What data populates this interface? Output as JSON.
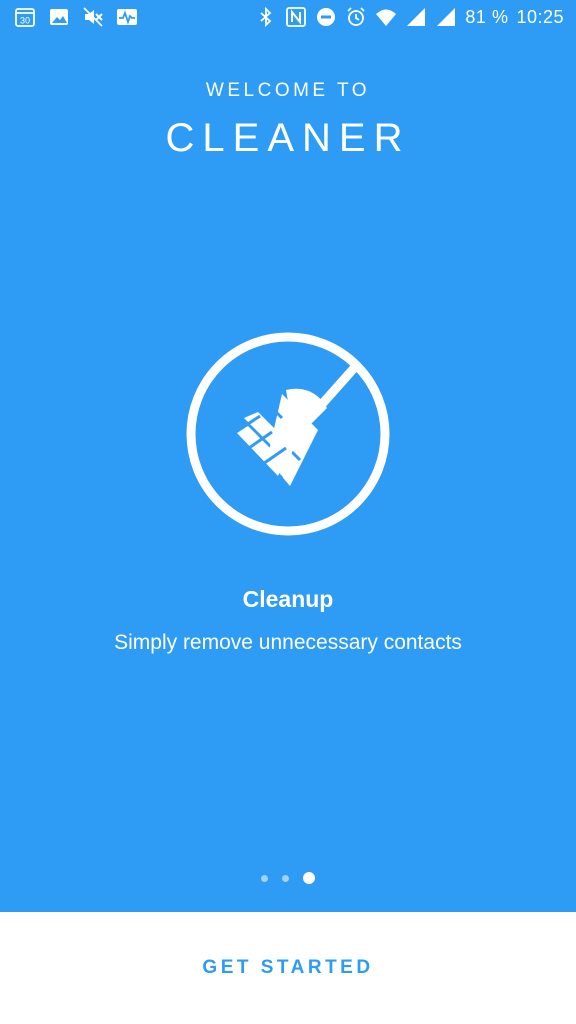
{
  "status_bar": {
    "battery_text": "81 %",
    "time": "10:25",
    "calendar_day": "30",
    "left_icons": [
      "calendar-icon",
      "image-icon",
      "mute-icon",
      "activity-icon"
    ],
    "right_icons": [
      "bluetooth-icon",
      "nfc-icon",
      "do-not-disturb-icon",
      "alarm-icon",
      "wifi-icon",
      "signal-icon",
      "signal-icon-2"
    ]
  },
  "header": {
    "welcome": "WELCOME TO",
    "app_name": "CLEANER"
  },
  "feature": {
    "icon": "broom-icon",
    "title": "Cleanup",
    "description": "Simply remove unnecessary contacts"
  },
  "pager": {
    "count": 3,
    "active_index": 2
  },
  "actions": {
    "get_started_label": "GET STARTED"
  },
  "colors": {
    "background": "#2e9cf5",
    "accent": "#2e9cf5",
    "foreground": "#ffffff",
    "bottom_bar": "#ffffff"
  }
}
